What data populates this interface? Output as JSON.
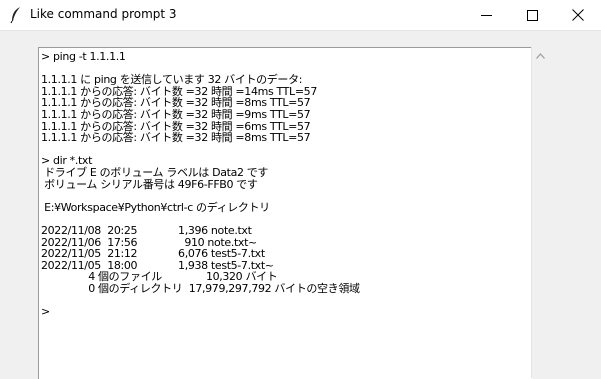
{
  "window": {
    "title": "Like command prompt 3",
    "icon": "feather-icon",
    "controls": [
      "minimize-icon",
      "maximize-icon",
      "close-icon"
    ]
  },
  "console": {
    "lines": [
      "> ping -t 1.1.1.1",
      "",
      "1.1.1.1 に ping を送信しています 32 バイトのデータ:",
      "1.1.1.1 からの応答: バイト数 =32 時間 =14ms TTL=57",
      "1.1.1.1 からの応答: バイト数 =32 時間 =8ms TTL=57",
      "1.1.1.1 からの応答: バイト数 =32 時間 =9ms TTL=57",
      "1.1.1.1 からの応答: バイト数 =32 時間 =6ms TTL=57",
      "1.1.1.1 からの応答: バイト数 =32 時間 =8ms TTL=57",
      "",
      "> dir *.txt",
      " ドライブ E のボリューム ラベルは Data2 です",
      " ボリューム シリアル番号は 49F6-FFB0 です",
      "",
      " E:¥Workspace¥Python¥ctrl-c のディレクトリ",
      "",
      "2022/11/08  20:25             1,396 note.txt",
      "2022/11/06  17:56               910 note.txt~",
      "2022/11/05  21:12             6,076 test5-7.txt",
      "2022/11/05  18:00             1,938 test5-7.txt~",
      "               4 個のファイル              10,320 バイト",
      "               0 個のディレクトリ  17,979,297,792 バイトの空き領域",
      "",
      ">"
    ]
  },
  "scrollbar": {
    "icon": "scroll-up-arrow-icon"
  }
}
